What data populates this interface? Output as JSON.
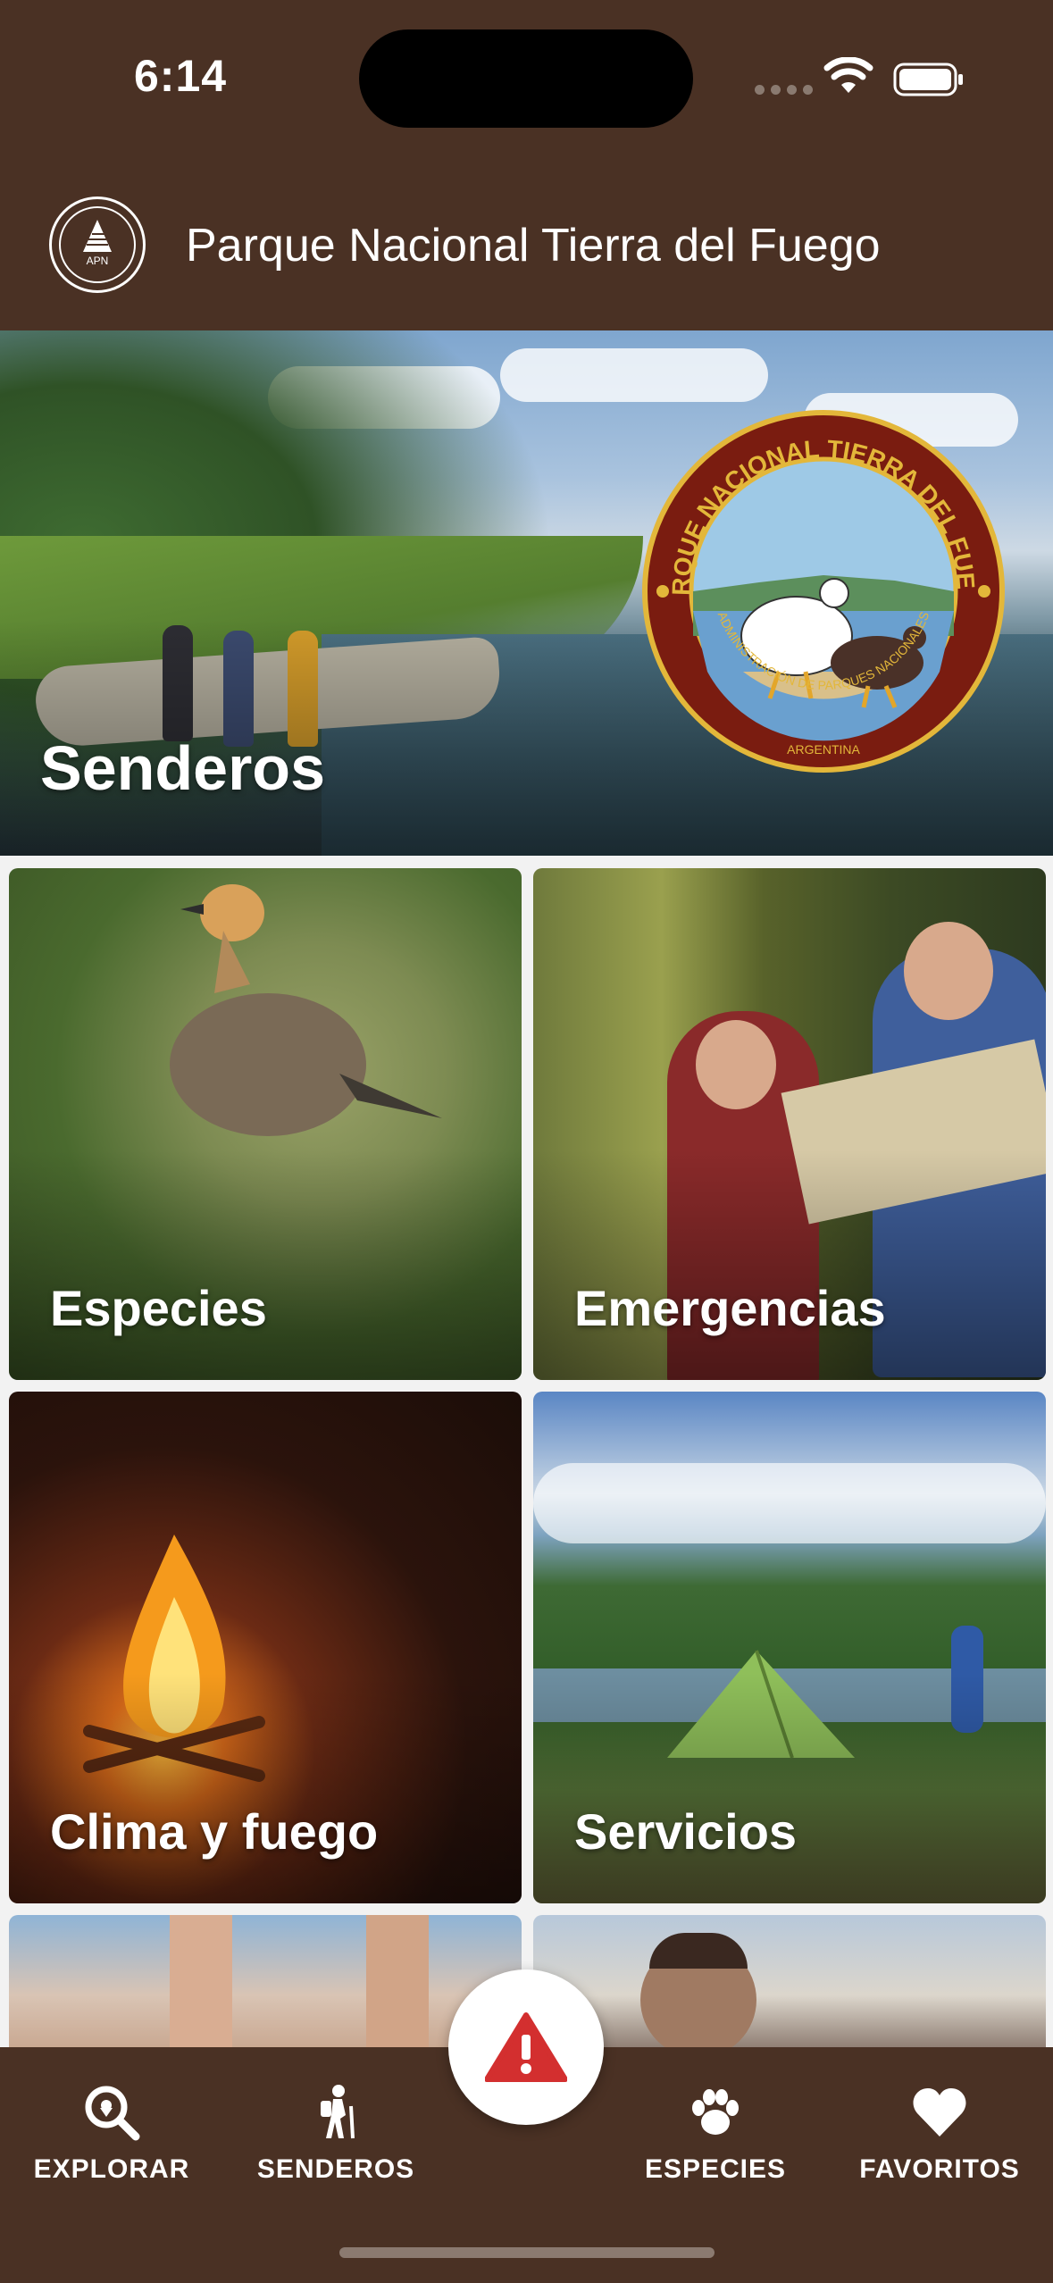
{
  "status": {
    "time": "6:14"
  },
  "header": {
    "title": "Parque Nacional Tierra del Fuego",
    "logo_text": "APN"
  },
  "hero": {
    "title": "Senderos",
    "seal_top_text": "PARQUE NACIONAL TIERRA DEL FUEGO",
    "seal_bottom_text": "ADMINISTRACIÓN DE PARQUES NACIONALES",
    "seal_country": "ARGENTINA"
  },
  "cards": [
    {
      "title": "Especies"
    },
    {
      "title": "Emergencias"
    },
    {
      "title": "Clima y fuego"
    },
    {
      "title": "Servicios"
    }
  ],
  "nav": {
    "items": [
      {
        "label": "EXPLORAR",
        "icon": "search-location-icon"
      },
      {
        "label": "SENDEROS",
        "icon": "hiker-icon"
      },
      {
        "label": "ESPECIES",
        "icon": "paw-icon"
      },
      {
        "label": "FAVORITOS",
        "icon": "heart-icon"
      }
    ],
    "fab_icon": "warning-icon"
  },
  "colors": {
    "brand_brown": "#4a3124",
    "alert_red": "#d32f2f",
    "grid_bg": "#f2f2f2"
  }
}
